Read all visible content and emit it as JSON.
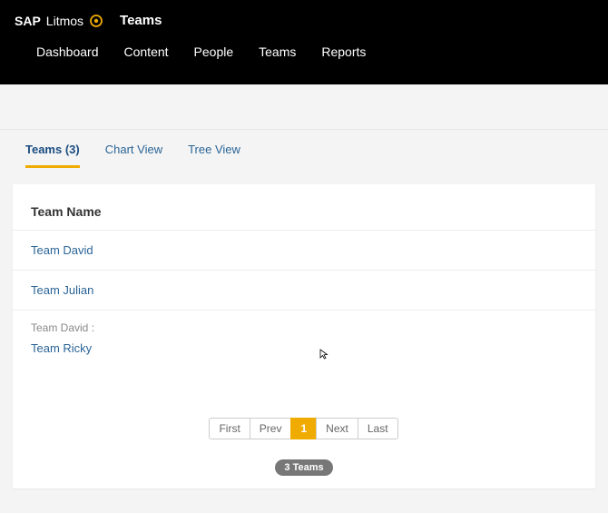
{
  "brand": {
    "primary": "SAP",
    "secondary": "Litmos"
  },
  "page_title": "Teams",
  "nav": {
    "items": [
      "Dashboard",
      "Content",
      "People",
      "Teams",
      "Reports"
    ]
  },
  "tabs": {
    "teams": "Teams (3)",
    "chart": "Chart View",
    "tree": "Tree View"
  },
  "table": {
    "header": "Team Name",
    "rows": [
      {
        "name": "Team David"
      },
      {
        "name": "Team Julian"
      },
      {
        "parent": "Team David :",
        "name": "Team Ricky"
      }
    ]
  },
  "pagination": {
    "first": "First",
    "prev": "Prev",
    "page": "1",
    "next": "Next",
    "last": "Last"
  },
  "summary": {
    "total": "3 Teams"
  }
}
